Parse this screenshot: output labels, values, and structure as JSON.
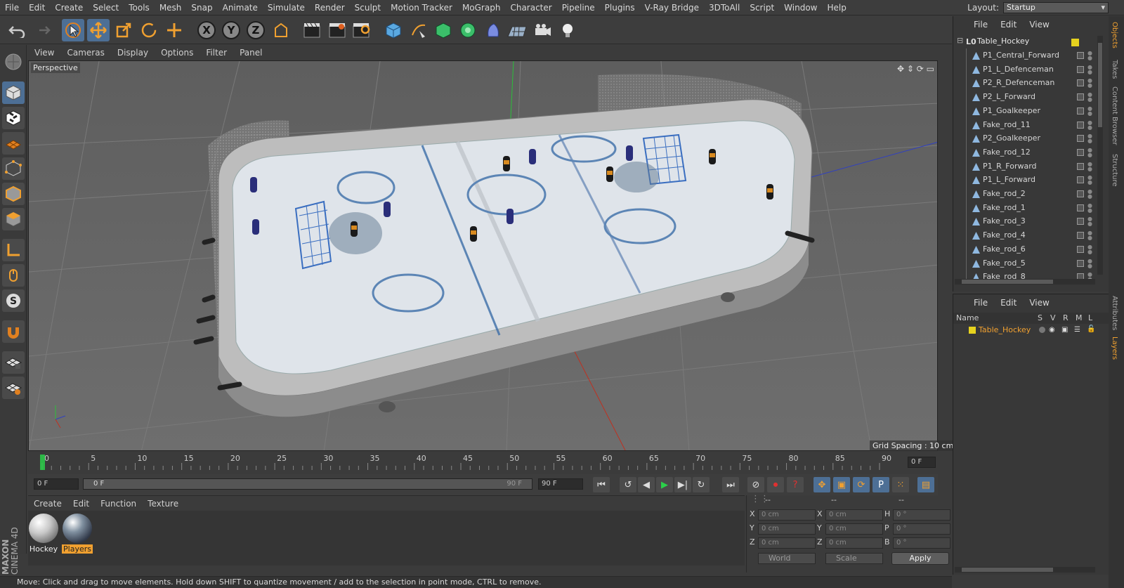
{
  "menubar": [
    "File",
    "Edit",
    "Create",
    "Select",
    "Tools",
    "Mesh",
    "Snap",
    "Animate",
    "Simulate",
    "Render",
    "Sculpt",
    "Motion Tracker",
    "MoGraph",
    "Character",
    "Pipeline",
    "Plugins",
    "V-Ray Bridge",
    "3DToAll",
    "Script",
    "Window",
    "Help"
  ],
  "layout": {
    "label": "Layout:",
    "value": "Startup"
  },
  "viewport": {
    "menu": [
      "View",
      "Cameras",
      "Display",
      "Options",
      "Filter",
      "Panel"
    ],
    "label": "Perspective",
    "grid_spacing": "Grid Spacing : 10 cm"
  },
  "timeline": {
    "ticks": [
      "0",
      "5",
      "10",
      "15",
      "20",
      "25",
      "30",
      "35",
      "40",
      "45",
      "50",
      "55",
      "60",
      "65",
      "70",
      "75",
      "80",
      "85",
      "90"
    ],
    "current_frame_right": "0 F",
    "start_field": "0 F",
    "slider_start": "0 F",
    "slider_end": "90 F",
    "end_field": "90 F"
  },
  "materials": {
    "menu": [
      "Create",
      "Edit",
      "Function",
      "Texture"
    ],
    "items": [
      {
        "name": "Hockey",
        "selected": false
      },
      {
        "name": "Players",
        "selected": true
      }
    ]
  },
  "coordinates": {
    "header": [
      "--",
      "--",
      "--"
    ],
    "rows": [
      {
        "a": "X",
        "av": "0 cm",
        "b": "X",
        "bv": "0 cm",
        "c": "H",
        "cv": "0 °"
      },
      {
        "a": "Y",
        "av": "0 cm",
        "b": "Y",
        "bv": "0 cm",
        "c": "P",
        "cv": "0 °"
      },
      {
        "a": "Z",
        "av": "0 cm",
        "b": "Z",
        "bv": "0 cm",
        "c": "B",
        "cv": "0 °"
      }
    ],
    "mode": "World",
    "scale": "Scale",
    "apply": "Apply"
  },
  "status": "Move: Click and drag to move elements. Hold down SHIFT to quantize movement / add to the selection in point mode, CTRL to remove.",
  "object_manager": {
    "menu": [
      "File",
      "Edit",
      "View"
    ],
    "root": "Table_Hockey",
    "children": [
      "P1_Central_Forward",
      "P1_L_Defenceman",
      "P2_R_Defenceman",
      "P2_L_Forward",
      "P1_Goalkeeper",
      "Fake_rod_11",
      "P2_Goalkeeper",
      "Fake_rod_12",
      "P1_R_Forward",
      "P1_L_Forward",
      "Fake_rod_2",
      "Fake_rod_1",
      "Fake_rod_3",
      "Fake_rod_4",
      "Fake_rod_6",
      "Fake_rod_5",
      "Fake_rod_8"
    ]
  },
  "layer_manager": {
    "menu": [
      "File",
      "Edit",
      "View"
    ],
    "columns": {
      "name": "Name",
      "s": "S",
      "v": "V",
      "r": "R",
      "m": "M",
      "l": "L"
    },
    "layer": "Table_Hockey"
  },
  "right_tabs": [
    "Objects",
    "Takes",
    "Content Browser",
    "Structure",
    "Attributes",
    "Layers"
  ],
  "logo": [
    "MAXON",
    "CINEMA 4D"
  ],
  "colors": {
    "accent": "#4d6f95",
    "selected_orange": "#f0a030",
    "layer_yellow": "#e6d21e"
  }
}
